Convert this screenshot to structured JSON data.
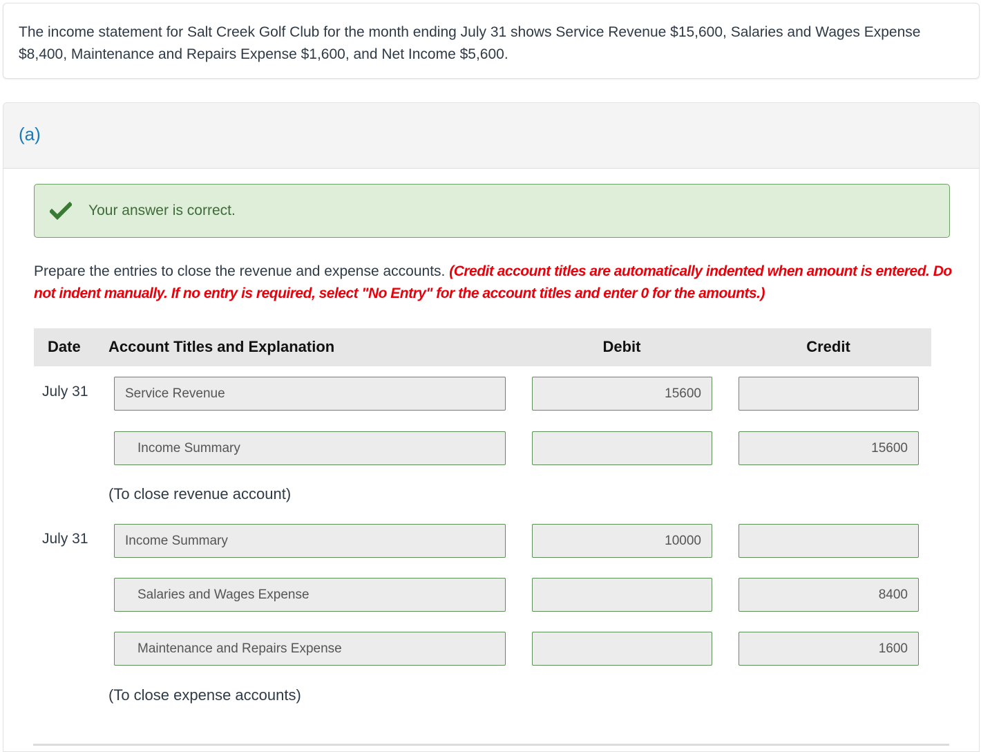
{
  "question": {
    "text": "The income statement for Salt Creek Golf Club for the month ending July 31 shows Service Revenue $15,600, Salaries and Wages Expense $8,400, Maintenance and Repairs Expense $1,600, and Net Income $5,600."
  },
  "part": {
    "label": "(a)",
    "feedback": {
      "icon": "check-icon",
      "text": "Your answer is correct.",
      "color": "#3f6b3a",
      "background": "#dfeed9"
    },
    "instructions": {
      "main": "Prepare the entries to close the revenue and expense accounts. ",
      "note": "(Credit account titles are automatically indented when amount is entered. Do not indent manually. If no entry is required, select \"No Entry\" for the account titles and enter 0 for the amounts.)",
      "note_color": "#e8000b"
    },
    "journal": {
      "headers": {
        "date": "Date",
        "account": "Account Titles and Explanation",
        "debit": "Debit",
        "credit": "Credit"
      },
      "entries": [
        {
          "date": "July 31",
          "lines": [
            {
              "account": "Service Revenue",
              "debit": "15600",
              "credit": ""
            },
            {
              "account": "Income Summary",
              "debit": "",
              "credit": "15600"
            }
          ],
          "explanation": "(To close revenue account)"
        },
        {
          "date": "July 31",
          "lines": [
            {
              "account": "Income Summary",
              "debit": "10000",
              "credit": ""
            },
            {
              "account": "Salaries and Wages Expense",
              "debit": "",
              "credit": "8400"
            },
            {
              "account": "Maintenance and Repairs Expense",
              "debit": "",
              "credit": "1600"
            }
          ],
          "explanation": "(To close expense accounts)"
        }
      ]
    }
  }
}
